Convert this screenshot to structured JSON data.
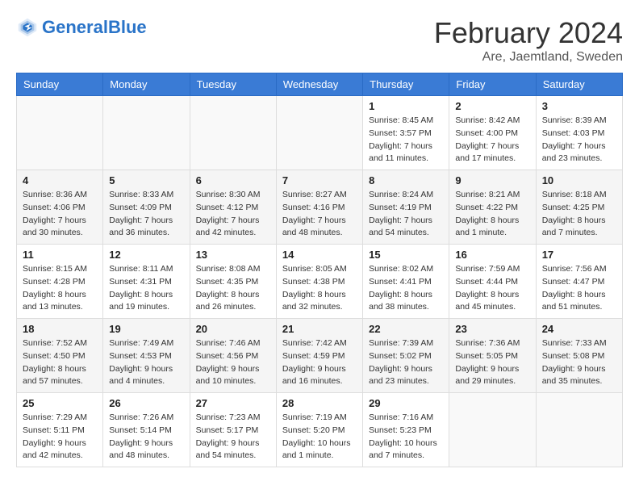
{
  "header": {
    "logo_text_general": "General",
    "logo_text_blue": "Blue",
    "month_title": "February 2024",
    "location": "Are, Jaemtland, Sweden"
  },
  "days_of_week": [
    "Sunday",
    "Monday",
    "Tuesday",
    "Wednesday",
    "Thursday",
    "Friday",
    "Saturday"
  ],
  "weeks": [
    [
      {
        "day": "",
        "info": ""
      },
      {
        "day": "",
        "info": ""
      },
      {
        "day": "",
        "info": ""
      },
      {
        "day": "",
        "info": ""
      },
      {
        "day": "1",
        "info": "Sunrise: 8:45 AM\nSunset: 3:57 PM\nDaylight: 7 hours\nand 11 minutes."
      },
      {
        "day": "2",
        "info": "Sunrise: 8:42 AM\nSunset: 4:00 PM\nDaylight: 7 hours\nand 17 minutes."
      },
      {
        "day": "3",
        "info": "Sunrise: 8:39 AM\nSunset: 4:03 PM\nDaylight: 7 hours\nand 23 minutes."
      }
    ],
    [
      {
        "day": "4",
        "info": "Sunrise: 8:36 AM\nSunset: 4:06 PM\nDaylight: 7 hours\nand 30 minutes."
      },
      {
        "day": "5",
        "info": "Sunrise: 8:33 AM\nSunset: 4:09 PM\nDaylight: 7 hours\nand 36 minutes."
      },
      {
        "day": "6",
        "info": "Sunrise: 8:30 AM\nSunset: 4:12 PM\nDaylight: 7 hours\nand 42 minutes."
      },
      {
        "day": "7",
        "info": "Sunrise: 8:27 AM\nSunset: 4:16 PM\nDaylight: 7 hours\nand 48 minutes."
      },
      {
        "day": "8",
        "info": "Sunrise: 8:24 AM\nSunset: 4:19 PM\nDaylight: 7 hours\nand 54 minutes."
      },
      {
        "day": "9",
        "info": "Sunrise: 8:21 AM\nSunset: 4:22 PM\nDaylight: 8 hours\nand 1 minute."
      },
      {
        "day": "10",
        "info": "Sunrise: 8:18 AM\nSunset: 4:25 PM\nDaylight: 8 hours\nand 7 minutes."
      }
    ],
    [
      {
        "day": "11",
        "info": "Sunrise: 8:15 AM\nSunset: 4:28 PM\nDaylight: 8 hours\nand 13 minutes."
      },
      {
        "day": "12",
        "info": "Sunrise: 8:11 AM\nSunset: 4:31 PM\nDaylight: 8 hours\nand 19 minutes."
      },
      {
        "day": "13",
        "info": "Sunrise: 8:08 AM\nSunset: 4:35 PM\nDaylight: 8 hours\nand 26 minutes."
      },
      {
        "day": "14",
        "info": "Sunrise: 8:05 AM\nSunset: 4:38 PM\nDaylight: 8 hours\nand 32 minutes."
      },
      {
        "day": "15",
        "info": "Sunrise: 8:02 AM\nSunset: 4:41 PM\nDaylight: 8 hours\nand 38 minutes."
      },
      {
        "day": "16",
        "info": "Sunrise: 7:59 AM\nSunset: 4:44 PM\nDaylight: 8 hours\nand 45 minutes."
      },
      {
        "day": "17",
        "info": "Sunrise: 7:56 AM\nSunset: 4:47 PM\nDaylight: 8 hours\nand 51 minutes."
      }
    ],
    [
      {
        "day": "18",
        "info": "Sunrise: 7:52 AM\nSunset: 4:50 PM\nDaylight: 8 hours\nand 57 minutes."
      },
      {
        "day": "19",
        "info": "Sunrise: 7:49 AM\nSunset: 4:53 PM\nDaylight: 9 hours\nand 4 minutes."
      },
      {
        "day": "20",
        "info": "Sunrise: 7:46 AM\nSunset: 4:56 PM\nDaylight: 9 hours\nand 10 minutes."
      },
      {
        "day": "21",
        "info": "Sunrise: 7:42 AM\nSunset: 4:59 PM\nDaylight: 9 hours\nand 16 minutes."
      },
      {
        "day": "22",
        "info": "Sunrise: 7:39 AM\nSunset: 5:02 PM\nDaylight: 9 hours\nand 23 minutes."
      },
      {
        "day": "23",
        "info": "Sunrise: 7:36 AM\nSunset: 5:05 PM\nDaylight: 9 hours\nand 29 minutes."
      },
      {
        "day": "24",
        "info": "Sunrise: 7:33 AM\nSunset: 5:08 PM\nDaylight: 9 hours\nand 35 minutes."
      }
    ],
    [
      {
        "day": "25",
        "info": "Sunrise: 7:29 AM\nSunset: 5:11 PM\nDaylight: 9 hours\nand 42 minutes."
      },
      {
        "day": "26",
        "info": "Sunrise: 7:26 AM\nSunset: 5:14 PM\nDaylight: 9 hours\nand 48 minutes."
      },
      {
        "day": "27",
        "info": "Sunrise: 7:23 AM\nSunset: 5:17 PM\nDaylight: 9 hours\nand 54 minutes."
      },
      {
        "day": "28",
        "info": "Sunrise: 7:19 AM\nSunset: 5:20 PM\nDaylight: 10 hours\nand 1 minute."
      },
      {
        "day": "29",
        "info": "Sunrise: 7:16 AM\nSunset: 5:23 PM\nDaylight: 10 hours\nand 7 minutes."
      },
      {
        "day": "",
        "info": ""
      },
      {
        "day": "",
        "info": ""
      }
    ]
  ]
}
